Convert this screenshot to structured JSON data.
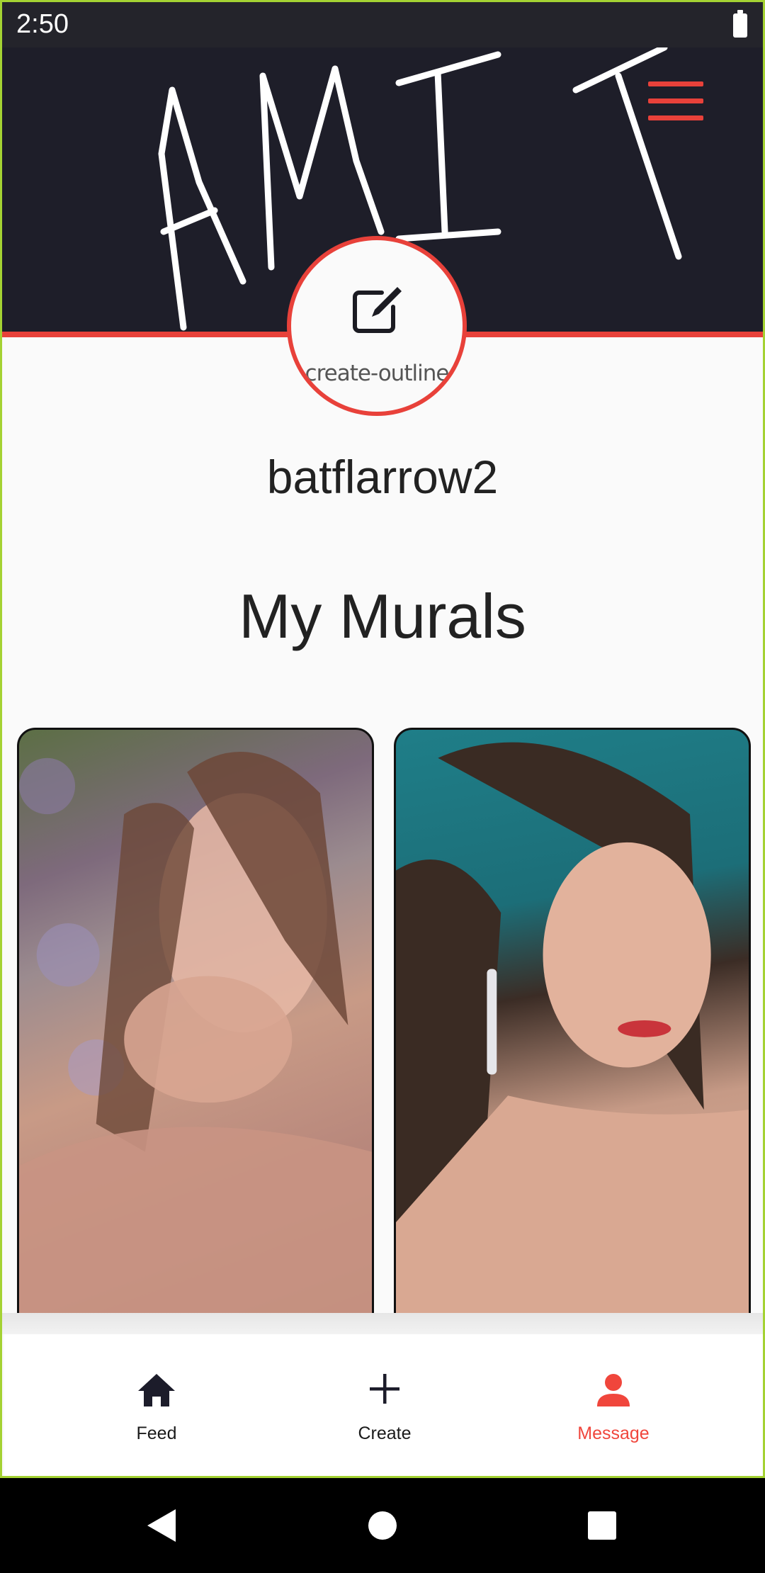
{
  "status_bar": {
    "time": "2:50"
  },
  "header": {
    "signature_icon": "handwritten-amit-banner",
    "menu_icon": "hamburger-menu-icon",
    "accent_color": "#e8413a",
    "background_color": "#1e1e29"
  },
  "profile": {
    "avatar_alt": "create-outline",
    "username": "batflarrow2"
  },
  "section": {
    "title": "My Murals"
  },
  "murals": [
    {
      "icon": "mural-image-1"
    },
    {
      "icon": "mural-image-2"
    }
  ],
  "bottom_nav": {
    "items": [
      {
        "label": "Feed",
        "icon": "home-icon"
      },
      {
        "label": "Create",
        "icon": "plus-icon"
      },
      {
        "label": "Message",
        "icon": "person-icon",
        "active": true
      }
    ],
    "active_color": "#f0463c"
  },
  "system_nav": {
    "icons": [
      "back-icon",
      "home-circle-icon",
      "recents-icon"
    ]
  }
}
